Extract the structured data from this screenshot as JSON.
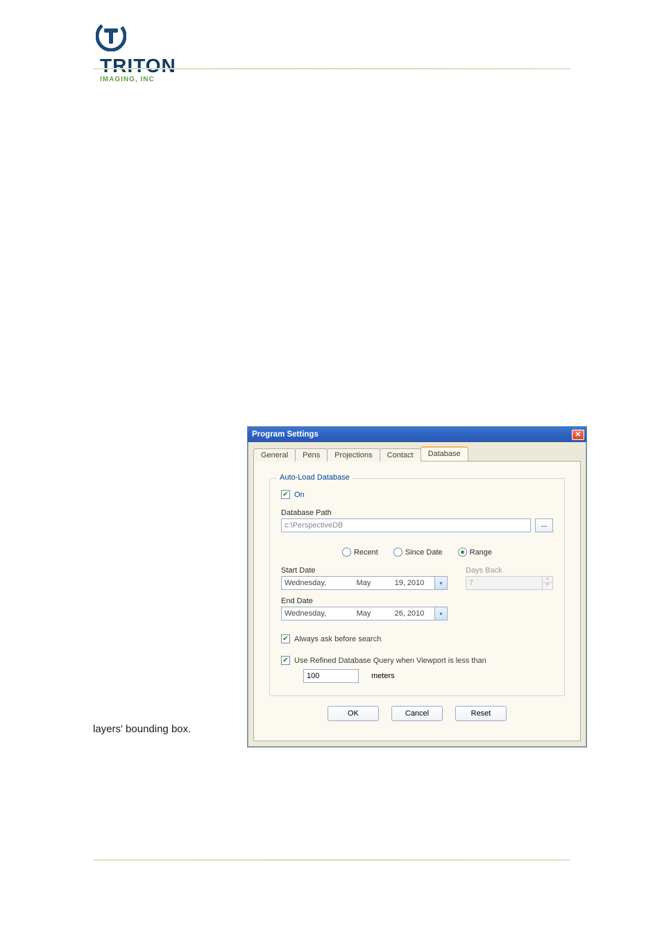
{
  "logo": {
    "main": "TRITON",
    "sub": "IMAGING, INC"
  },
  "visible_fragment": "layers' bounding box.",
  "dialog": {
    "title": "Program Settings",
    "tabs": {
      "general": "General",
      "pens": "Pens",
      "projections": "Projections",
      "contact": "Contact",
      "database": "Database"
    },
    "group_title": "Auto-Load Database",
    "on_checkbox": {
      "label": "On",
      "checked": true
    },
    "db_path_label": "Database Path",
    "db_path_value": "c:\\PerspectiveDB",
    "browse_btn": "...",
    "radios": {
      "recent": "Recent",
      "since": "Since Date",
      "range": "Range",
      "selected": "range"
    },
    "start_date_label": "Start Date",
    "start_date": {
      "weekday": "Wednesday,",
      "month": "May",
      "daynum": "19, 2010"
    },
    "days_back_label": "Days Back",
    "days_back_value": "7",
    "end_date_label": "End Date",
    "end_date": {
      "weekday": "Wednesday,",
      "month": "May",
      "daynum": "26, 2010"
    },
    "always_ask": {
      "label": "Always ask before search",
      "checked": true
    },
    "refined": {
      "label": "Use Refined Database Query when Viewport is less than",
      "checked": true
    },
    "threshold_value": "100",
    "threshold_unit": "meters",
    "buttons": {
      "ok": "OK",
      "cancel": "Cancel",
      "reset": "Reset"
    },
    "close_glyph": "✕",
    "chevron_glyph": "▾",
    "spin_up": "▲",
    "spin_down": "▼",
    "check_glyph": "✔"
  }
}
